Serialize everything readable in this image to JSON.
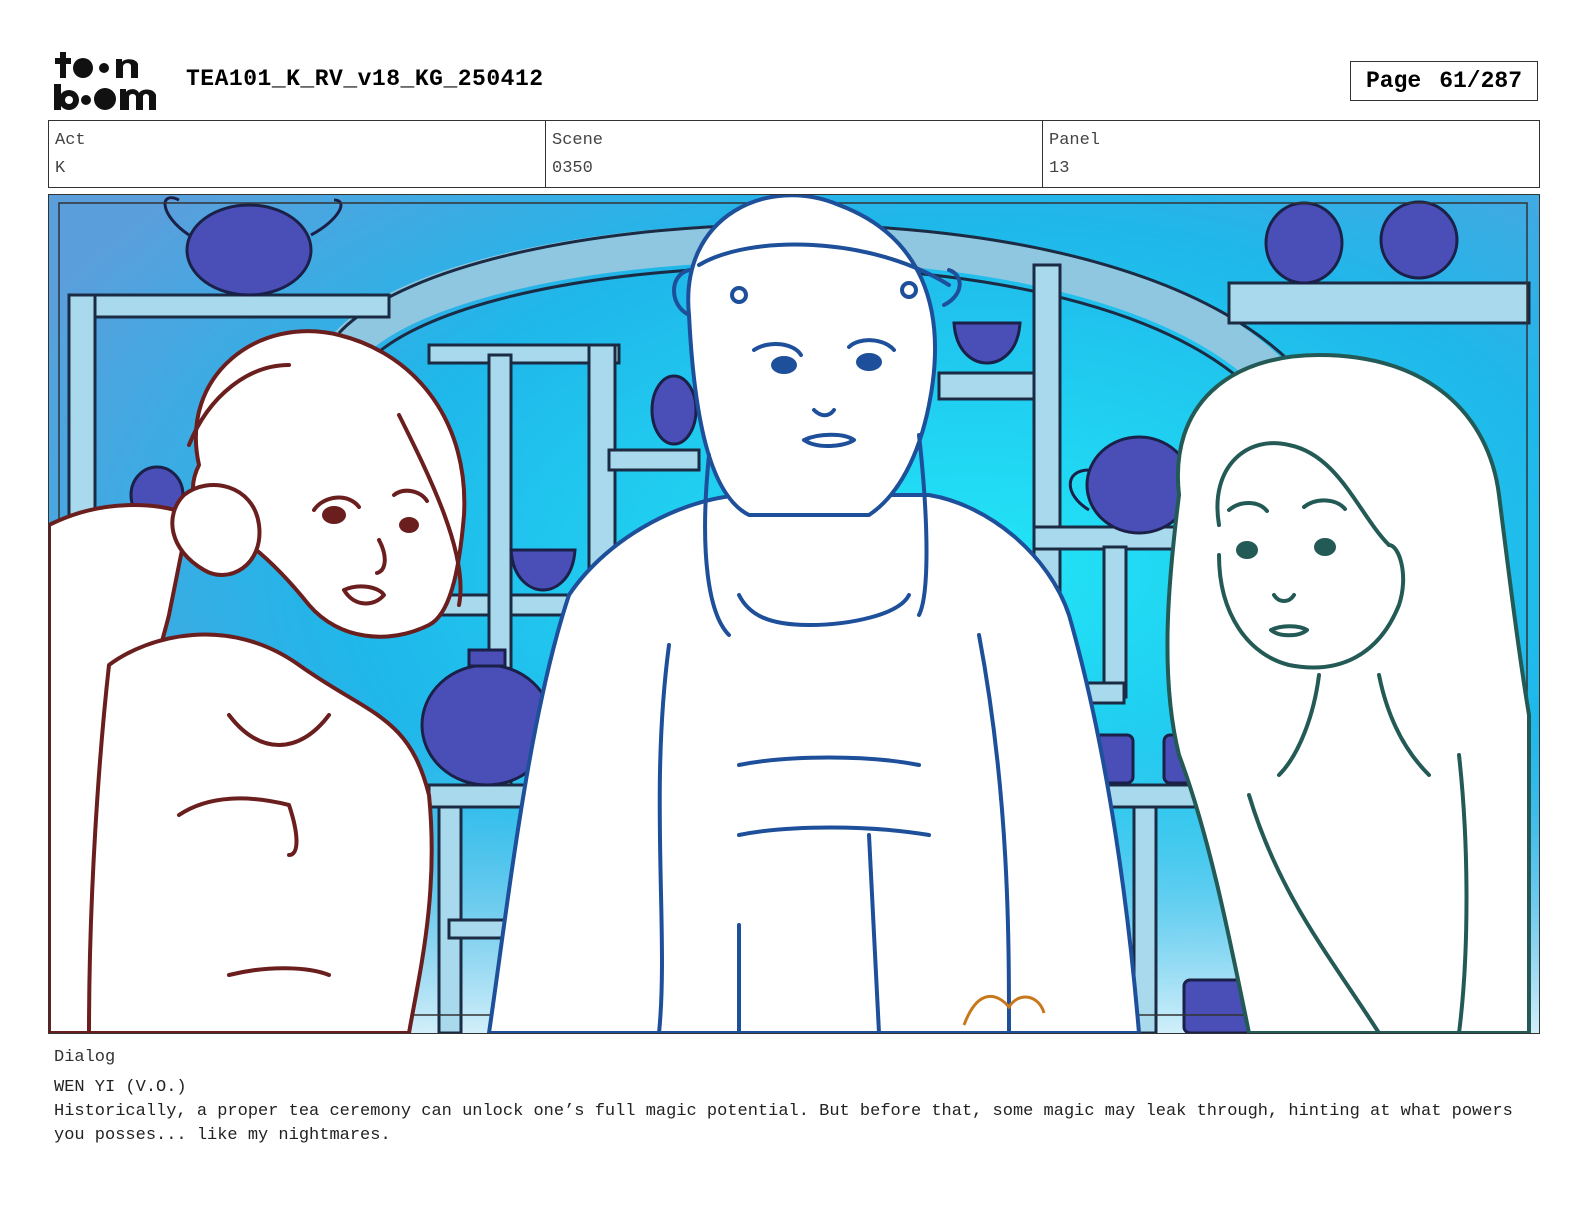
{
  "header": {
    "logo_text": "toonboom",
    "document_title": "TEA101_K_RV_v18_KG_250412",
    "page_label": "Page",
    "page_number": "61/287"
  },
  "info": {
    "act_label": "Act",
    "act_value": "K",
    "scene_label": "Scene",
    "scene_value": "0350",
    "panel_label": "Panel",
    "panel_value": "13"
  },
  "colors": {
    "sky": "#2fd8f2",
    "shelf": "#9fd6ea",
    "pottery": "#4a4fb8",
    "left_character_line": "#6b1e1e",
    "center_character_line": "#1e4f9a",
    "right_character_line": "#235a55"
  },
  "dialog": {
    "heading": "Dialog",
    "speaker": "WEN YI (V.O.)",
    "line": "Historically, a proper tea ceremony can unlock one’s full magic potential. But before that, some magic may leak through, hinting at what powers you posses... like my nightmares."
  }
}
